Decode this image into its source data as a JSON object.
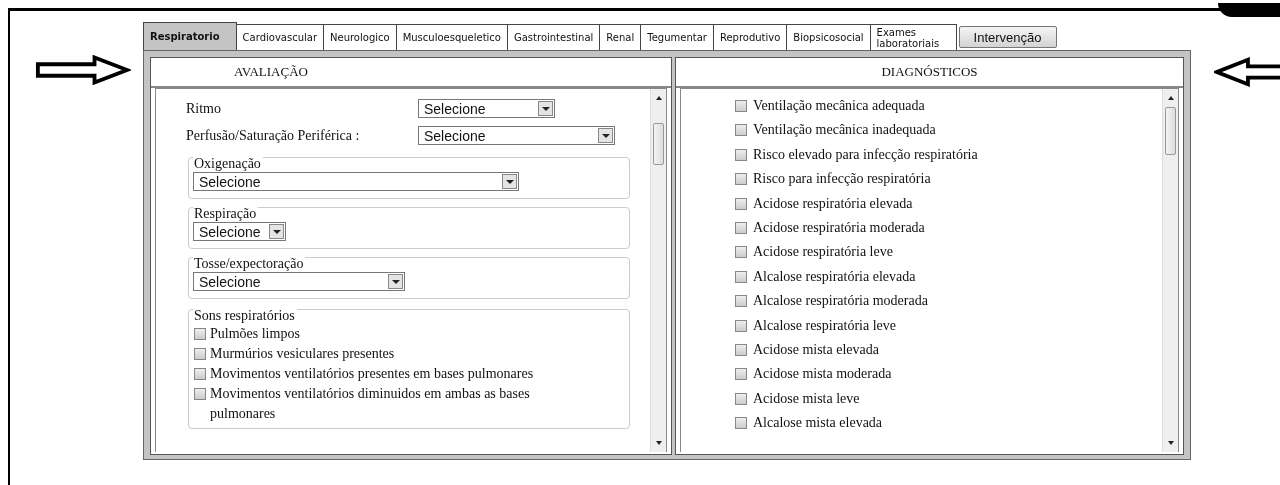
{
  "tabs": [
    {
      "label": "Respiratorio",
      "selected": true
    },
    {
      "label": "Cardiovascular",
      "selected": false
    },
    {
      "label": "Neurologico",
      "selected": false
    },
    {
      "label": "Musculoesqueletico",
      "selected": false
    },
    {
      "label": "Gastrointestinal",
      "selected": false
    },
    {
      "label": "Renal",
      "selected": false
    },
    {
      "label": "Tegumentar",
      "selected": false
    },
    {
      "label": "Reprodutivo",
      "selected": false
    },
    {
      "label": "Biopsicosocial",
      "selected": false
    },
    {
      "label": "Exames laboratoriais",
      "selected": false
    }
  ],
  "intervention_button": "Intervenção",
  "evaluation": {
    "title": "AVALIAÇÃO",
    "fields": [
      {
        "kind": "select",
        "label": "Ritmo",
        "value": "Selecione"
      },
      {
        "kind": "select",
        "label": "Perfusão/Saturação Periférica :",
        "value": "Selecione"
      },
      {
        "kind": "group",
        "legend": "Oxigenação",
        "value": "Selecione"
      },
      {
        "kind": "group",
        "legend": "Respiração",
        "value": "Selecione"
      },
      {
        "kind": "group",
        "legend": "Tosse/expectoração",
        "value": "Selecione"
      },
      {
        "kind": "checklist",
        "legend": "Sons respiratórios",
        "items": [
          {
            "label": "Pulmões limpos",
            "checked": false
          },
          {
            "label": "Murmúrios vesiculares presentes",
            "checked": false
          },
          {
            "label": "Movimentos ventilatórios presentes em bases pulmonares",
            "checked": false
          },
          {
            "label": "Movimentos ventilatórios diminuidos em ambas as bases pulmonares",
            "checked": false
          }
        ]
      }
    ]
  },
  "diagnoses": {
    "title": "DIAGNÓSTICOS",
    "items": [
      {
        "label": "Ventilação mecânica adequada",
        "checked": false
      },
      {
        "label": "Ventilação mecânica inadequada",
        "checked": false
      },
      {
        "label": "Risco elevado para infecção respiratória",
        "checked": false
      },
      {
        "label": "Risco para infecção respiratória",
        "checked": false
      },
      {
        "label": "Acidose respiratória elevada",
        "checked": false
      },
      {
        "label": "Acidose respiratória moderada",
        "checked": false
      },
      {
        "label": "Acidose respiratória leve",
        "checked": false
      },
      {
        "label": "Alcalose respiratória elevada",
        "checked": false
      },
      {
        "label": "Alcalose respiratória moderada",
        "checked": false
      },
      {
        "label": "Alcalose respiratória leve",
        "checked": false
      },
      {
        "label": "Acidose mista elevada",
        "checked": false
      },
      {
        "label": "Acidose mista moderada",
        "checked": false
      },
      {
        "label": "Acidose mista leve",
        "checked": false
      },
      {
        "label": "Alcalose mista elevada",
        "checked": false
      }
    ]
  }
}
